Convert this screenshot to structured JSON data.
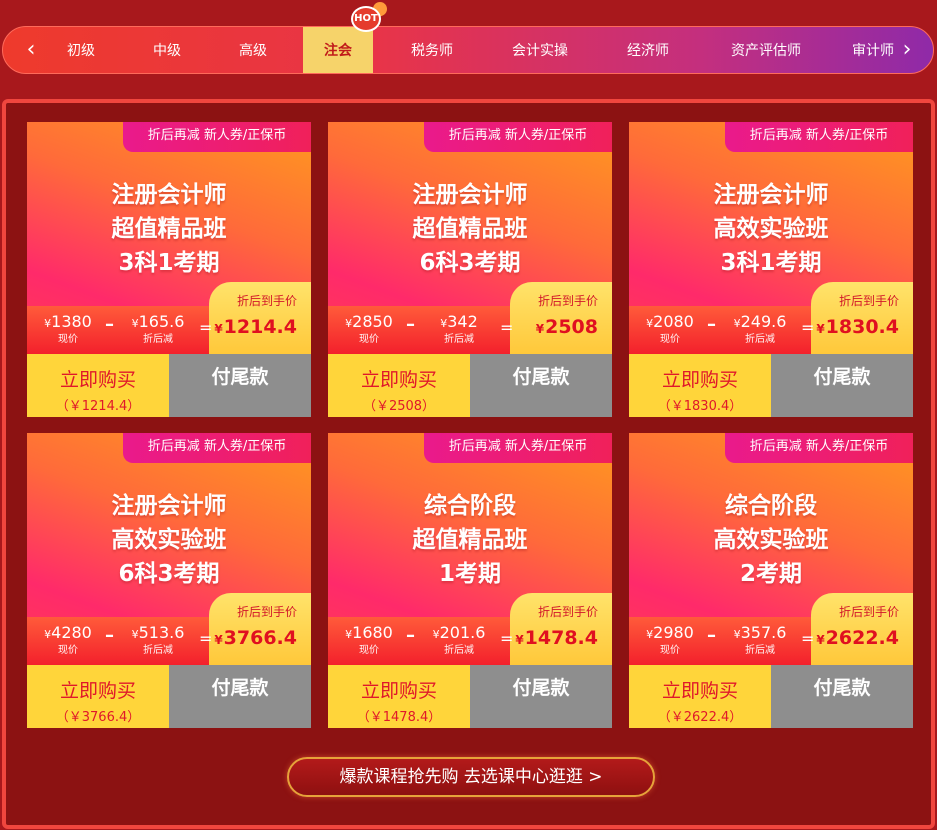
{
  "nav": {
    "left_arrow": "‹",
    "right_arrow": "›",
    "hot_badge": "HOT",
    "items": [
      {
        "label": "初级"
      },
      {
        "label": "中级"
      },
      {
        "label": "高级"
      },
      {
        "label": "注会",
        "active": true
      },
      {
        "label": "税务师"
      },
      {
        "label": "会计实操"
      },
      {
        "label": "经济师"
      },
      {
        "label": "资产评估师"
      },
      {
        "label": "审计师"
      }
    ]
  },
  "cards": [
    {
      "promo": "折后再减 新人券/正保币",
      "title_lines": [
        "注册会计师",
        "超值精品班",
        "3科1考期"
      ],
      "original": "1380",
      "original_caption": "现价",
      "discount": "165.6",
      "discount_caption": "折后减",
      "final_caption": "折后到手价",
      "final_price": "1214.4",
      "buy_label": "立即购买",
      "buy_price": "（￥1214.4）",
      "tail_label": "付尾款"
    },
    {
      "promo": "折后再减 新人券/正保币",
      "title_lines": [
        "注册会计师",
        "超值精品班",
        "6科3考期"
      ],
      "original": "2850",
      "original_caption": "现价",
      "discount": "342",
      "discount_caption": "折后减",
      "final_caption": "折后到手价",
      "final_price": "2508",
      "buy_label": "立即购买",
      "buy_price": "（￥2508）",
      "tail_label": "付尾款"
    },
    {
      "promo": "折后再减 新人券/正保币",
      "title_lines": [
        "注册会计师",
        "高效实验班",
        "3科1考期"
      ],
      "original": "2080",
      "original_caption": "现价",
      "discount": "249.6",
      "discount_caption": "折后减",
      "final_caption": "折后到手价",
      "final_price": "1830.4",
      "buy_label": "立即购买",
      "buy_price": "（￥1830.4）",
      "tail_label": "付尾款"
    },
    {
      "promo": "折后再减 新人券/正保币",
      "title_lines": [
        "注册会计师",
        "高效实验班",
        "6科3考期"
      ],
      "original": "4280",
      "original_caption": "现价",
      "discount": "513.6",
      "discount_caption": "折后减",
      "final_caption": "折后到手价",
      "final_price": "3766.4",
      "buy_label": "立即购买",
      "buy_price": "（￥3766.4）",
      "tail_label": "付尾款"
    },
    {
      "promo": "折后再减 新人券/正保币",
      "title_lines": [
        "综合阶段",
        "超值精品班",
        "1考期"
      ],
      "original": "1680",
      "original_caption": "现价",
      "discount": "201.6",
      "discount_caption": "折后减",
      "final_caption": "折后到手价",
      "final_price": "1478.4",
      "buy_label": "立即购买",
      "buy_price": "（￥1478.4）",
      "tail_label": "付尾款"
    },
    {
      "promo": "折后再减 新人券/正保币",
      "title_lines": [
        "综合阶段",
        "高效实验班",
        "2考期"
      ],
      "original": "2980",
      "original_caption": "现价",
      "discount": "357.6",
      "discount_caption": "折后减",
      "final_caption": "折后到手价",
      "final_price": "2622.4",
      "buy_label": "立即购买",
      "buy_price": "（￥2622.4）",
      "tail_label": "付尾款"
    }
  ],
  "currency": "¥",
  "cta": {
    "label": "爆款课程抢先购 去选课中心逛逛 >"
  },
  "colors": {
    "background": "#a8181c",
    "panel": "#8c1212",
    "active_tab": "#f6d36a",
    "buy_button": "#ffd53a",
    "tail_button": "#8e8e8e",
    "price_red": "#e01020"
  }
}
